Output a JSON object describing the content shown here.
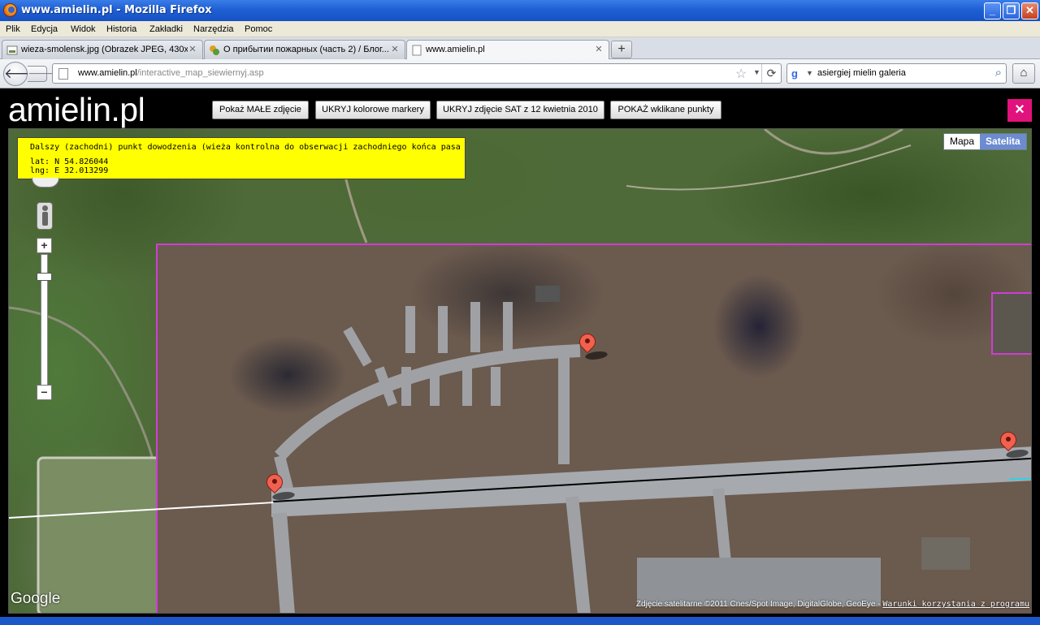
{
  "window": {
    "title": "www.amielin.pl - Mozilla Firefox"
  },
  "menu": [
    "Plik",
    "Edycja",
    "Widok",
    "Historia",
    "Zakładki",
    "Narzędzia",
    "Pomoc"
  ],
  "tabs": [
    {
      "label": "wieza-smolensk.jpg (Obrazek JPEG, 430x..."
    },
    {
      "label": "О прибытии пожарных (часть 2) / Блог..."
    },
    {
      "label": "www.amielin.pl"
    }
  ],
  "nav": {
    "url_host": "www.amielin.pl",
    "url_path": "/interactive_map_siewiernyj.asp",
    "search_query": "asiergiej mielin galeria"
  },
  "page": {
    "logo": "amielin.pl",
    "buttons": [
      "Pokaż MAŁE zdjęcie",
      "UKRYJ kolorowe markery",
      "UKRYJ zdjęcie SAT z 12 kwietnia 2010",
      "POKAŻ wklikane punkty"
    ],
    "close_label": "×"
  },
  "map": {
    "info_title": "Dalszy (zachodni) punkt dowodzenia (wieża kontrolna do obserwacji zachodniego końca pasa",
    "info_lat": "lat:  N 54.826044",
    "info_lng": "lng: E 32.013299",
    "type_map": "Mapa",
    "type_satellite": "Satelita",
    "google": "Google",
    "attribution": "Zdjęcie satelitarne ©2011 Cnes/Spot Image, DigitalGlobe, GeoEye - ",
    "terms": "Warunki korzystania z programu",
    "zoom_in": "+",
    "zoom_out": "−"
  },
  "colors": {
    "overlay_border": "#d13cd6",
    "marker": "#f0614f",
    "info_bg": "#ffff00",
    "close_btn": "#e2127c"
  }
}
